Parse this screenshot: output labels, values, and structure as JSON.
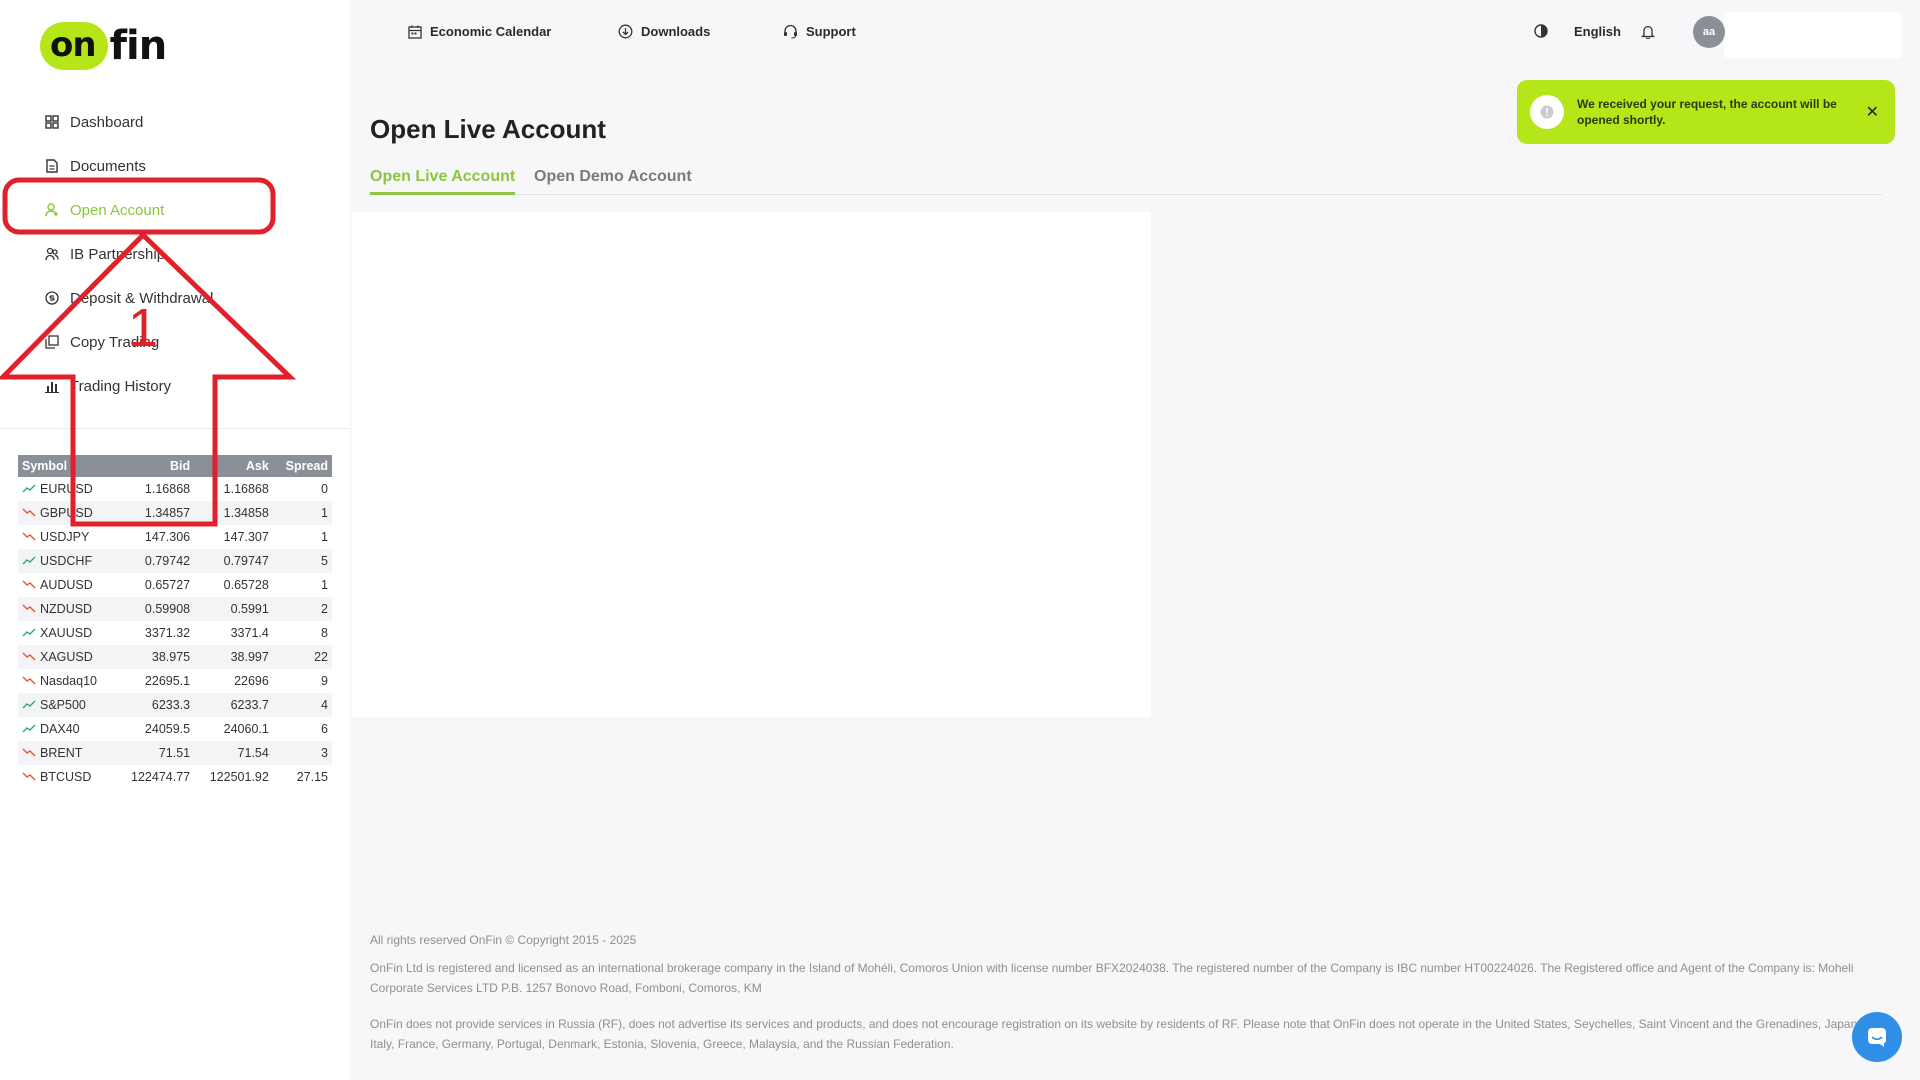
{
  "brand": {
    "logo_part1": "on",
    "logo_part2": "fin"
  },
  "sidebar": {
    "items": [
      {
        "label": "Dashboard",
        "icon": "dashboard-icon",
        "active": false
      },
      {
        "label": "Documents",
        "icon": "document-icon",
        "active": false
      },
      {
        "label": "Open Account",
        "icon": "user-add-icon",
        "active": true
      },
      {
        "label": "IB Partnership",
        "icon": "users-icon",
        "active": false
      },
      {
        "label": "Deposit & Withdrawal",
        "icon": "currency-icon",
        "active": false
      },
      {
        "label": "Copy Trading",
        "icon": "copy-icon",
        "active": false
      },
      {
        "label": "Trading History",
        "icon": "bar-chart-icon",
        "active": false
      }
    ]
  },
  "quotes": {
    "headers": {
      "symbol": "Symbol",
      "bid": "Bid",
      "ask": "Ask",
      "spread": "Spread"
    },
    "rows": [
      {
        "symbol": "EURUSD",
        "bid": "1.16868",
        "ask": "1.16868",
        "spread": "0",
        "trend": "up"
      },
      {
        "symbol": "GBPUSD",
        "bid": "1.34857",
        "ask": "1.34858",
        "spread": "1",
        "trend": "down"
      },
      {
        "symbol": "USDJPY",
        "bid": "147.306",
        "ask": "147.307",
        "spread": "1",
        "trend": "down"
      },
      {
        "symbol": "USDCHF",
        "bid": "0.79742",
        "ask": "0.79747",
        "spread": "5",
        "trend": "up"
      },
      {
        "symbol": "AUDUSD",
        "bid": "0.65727",
        "ask": "0.65728",
        "spread": "1",
        "trend": "down"
      },
      {
        "symbol": "NZDUSD",
        "bid": "0.59908",
        "ask": "0.5991",
        "spread": "2",
        "trend": "down"
      },
      {
        "symbol": "XAUUSD",
        "bid": "3371.32",
        "ask": "3371.4",
        "spread": "8",
        "trend": "up"
      },
      {
        "symbol": "XAGUSD",
        "bid": "38.975",
        "ask": "38.997",
        "spread": "22",
        "trend": "down"
      },
      {
        "symbol": "Nasdaq10",
        "bid": "22695.1",
        "ask": "22696",
        "spread": "9",
        "trend": "down"
      },
      {
        "symbol": "S&P500",
        "bid": "6233.3",
        "ask": "6233.7",
        "spread": "4",
        "trend": "up"
      },
      {
        "symbol": "DAX40",
        "bid": "24059.5",
        "ask": "24060.1",
        "spread": "6",
        "trend": "up"
      },
      {
        "symbol": "BRENT",
        "bid": "71.51",
        "ask": "71.54",
        "spread": "3",
        "trend": "down"
      },
      {
        "symbol": "BTCUSD",
        "bid": "122474.77",
        "ask": "122501.92",
        "spread": "27.15",
        "trend": "down"
      }
    ]
  },
  "topbar": {
    "economic_calendar": "Economic Calendar",
    "downloads": "Downloads",
    "support": "Support",
    "language": "English",
    "avatar_initials": "aa"
  },
  "toast": {
    "message": "We received your request, the account will be opened shortly."
  },
  "main": {
    "title": "Open Live Account",
    "tabs": [
      {
        "label": "Open Live Account",
        "active": true
      },
      {
        "label": "Open Demo Account",
        "active": false
      }
    ]
  },
  "footer": {
    "copyright": "All rights reserved OnFin © Copyright 2015 - 2025",
    "license": "OnFin Ltd is registered and licensed as an international brokerage company in the Island of Mohéli, Comoros Union with license number BFX2024038. The registered number of the Company is IBC number HT00224026. The Registered office and Agent of the Company is: Moheli Corporate Services LTD P.B. 1257 Bonovo Road, Fomboni, Comoros, KM",
    "restrictions": "OnFin does not provide services in Russia (RF), does not advertise its services and products, and does not encourage registration on its website by residents of RF. Please note that OnFin does not operate in the United States, Seychelles, Saint Vincent and the Grenadines, Japan, Spain, Italy, France, Germany, Portugal, Denmark, Estonia, Slovenia, Greece, Malaysia, and the Russian Federation."
  },
  "annotation": {
    "step_number": "1",
    "color": "#e0202a"
  },
  "colors": {
    "accent": "#b4e61a",
    "active_text": "#8cc63f",
    "table_header": "#8a8f98",
    "trend_up": "#2aa876",
    "trend_down": "#e8552c"
  }
}
